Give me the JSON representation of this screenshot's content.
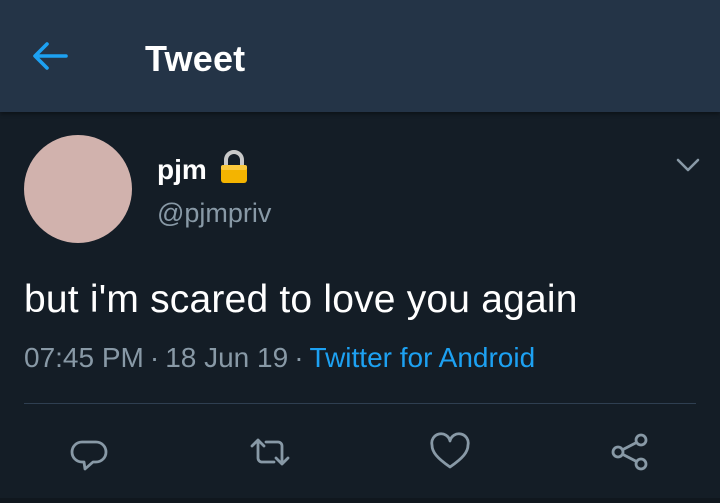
{
  "header": {
    "title": "Tweet",
    "back_icon": "back-arrow-icon"
  },
  "tweet": {
    "display_name": "pjm",
    "handle": "@pjmpriv",
    "text": "but i'm scared to love you again",
    "time": "07:45 PM",
    "separator": "·",
    "date": "18 Jun 19",
    "source": "Twitter for Android",
    "avatar_color": "#d1b2ad",
    "protected_icon": "lock-icon"
  },
  "actions": [
    "reply-icon",
    "retweet-icon",
    "like-icon",
    "share-icon"
  ],
  "colors": {
    "background": "#141d26",
    "header": "#243447",
    "accent": "#1da1f2",
    "secondary_text": "#8899a6"
  }
}
